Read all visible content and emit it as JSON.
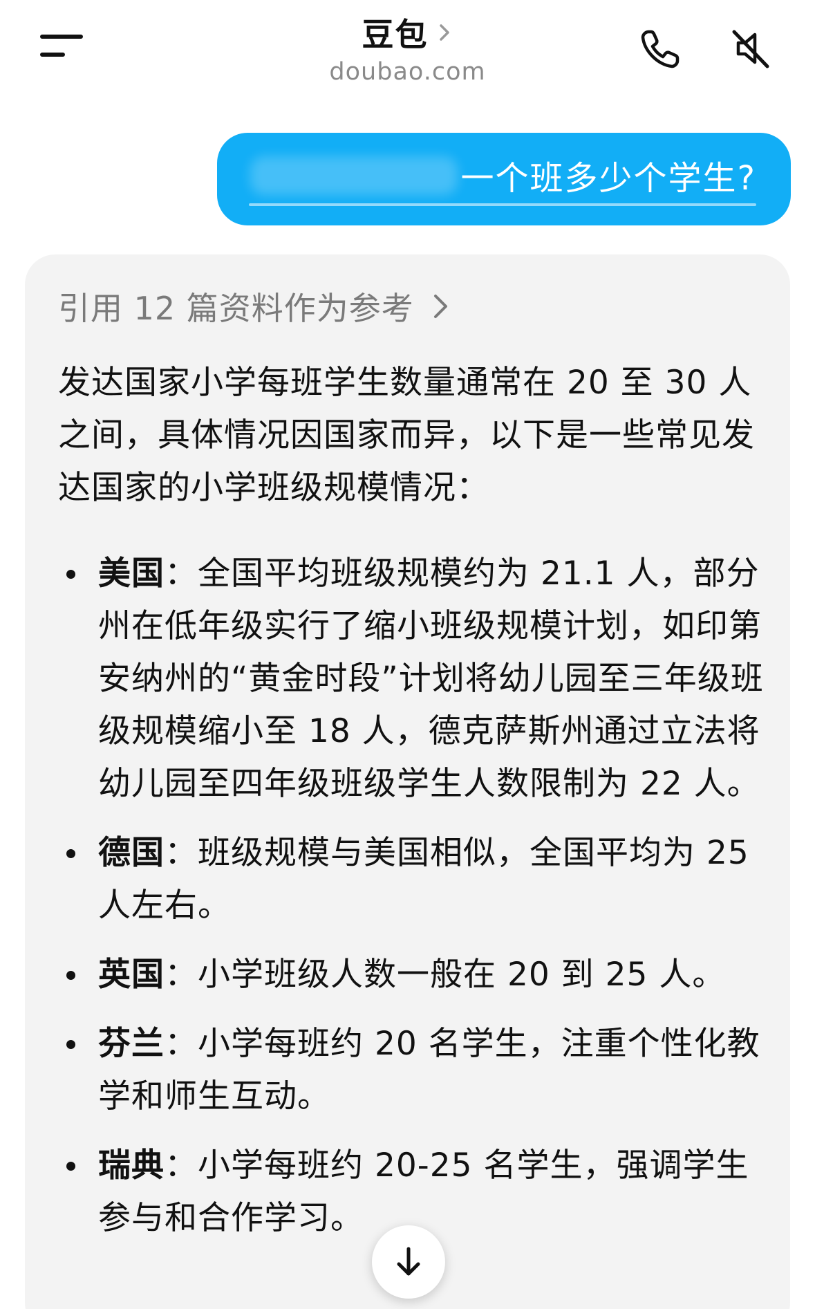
{
  "header": {
    "title": "豆包",
    "url": "doubao.com"
  },
  "icons": {
    "menu": "menu-icon",
    "title_chevron": "chevron-right-icon",
    "call": "phone-icon",
    "mute": "speaker-muted-icon",
    "scroll_down": "arrow-down-icon"
  },
  "colors": {
    "user_bubble": "#12aef6",
    "card_bg": "#f3f3f3",
    "muted_text": "#7a7a7a"
  },
  "user_message": {
    "text": "一个班多少个学生?"
  },
  "answer": {
    "references_label": "引用 12 篇资料作为参考",
    "intro": "发达国家小学每班学生数量通常在 20 至 30 人之间，具体情况因国家而异，以下是一些常见发达国家的小学班级规模情况：",
    "items": [
      {
        "label": "美国",
        "sep": "：",
        "text": "全国平均班级规模约为 21.1 人，部分州在低年级实行了缩小班级规模计划，如印第安纳州的“黄金时段”计划将幼儿园至三年级班级规模缩小至 18 人，德克萨斯州通过立法将幼儿园至四年级班级学生人数限制为 22 人。"
      },
      {
        "label": "德国",
        "sep": "：",
        "text": "班级规模与美国相似，全国平均为 25 人左右。"
      },
      {
        "label": "英国",
        "sep": "：",
        "text": "小学班级人数一般在 20 到 25 人。"
      },
      {
        "label": "芬兰",
        "sep": "：",
        "text": "小学每班约 20 名学生，注重个性化教学和师生互动。"
      },
      {
        "label": "瑞典",
        "sep": "：",
        "text": "小学每班约 20-25 名学生，强调学生参与和合作学习。"
      }
    ]
  }
}
